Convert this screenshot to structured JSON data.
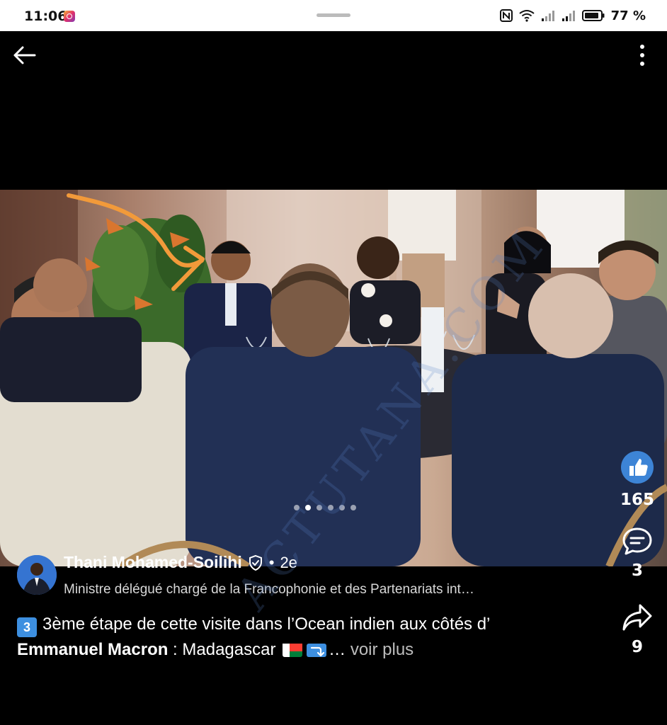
{
  "status_bar": {
    "time": "11:06",
    "battery": "77 %",
    "icons": [
      "instagram-notification-icon",
      "nfc-icon",
      "wifi-icon",
      "signal-icon",
      "signal-icon",
      "battery-icon"
    ]
  },
  "app_bar": {
    "back_icon": "arrow-left-icon",
    "more_icon": "more-vertical-icon"
  },
  "carousel": {
    "total": 6,
    "active_index": 1
  },
  "post": {
    "author_name": "Thani Mohamed-Soilihi",
    "verified_icon": "verified-shield-icon",
    "separator": "•",
    "degree": "2e",
    "author_title": "Ministre délégué chargé de la Francophonie et des Partenariats int…",
    "caption": {
      "keycap": "3",
      "line1": "3ème étape de cette visite dans l’Ocean indien aux côtés d’",
      "mention": "Emmanuel Macron",
      "line2": " : Madagascar ",
      "ellipsis": "…",
      "see_more": "voir plus"
    }
  },
  "actions": {
    "likes": "165",
    "comments": "3",
    "shares": "9"
  },
  "watermark": "ACTUTANA.COM",
  "colors": {
    "like_blue": "#3d84d6",
    "background": "#000000"
  }
}
